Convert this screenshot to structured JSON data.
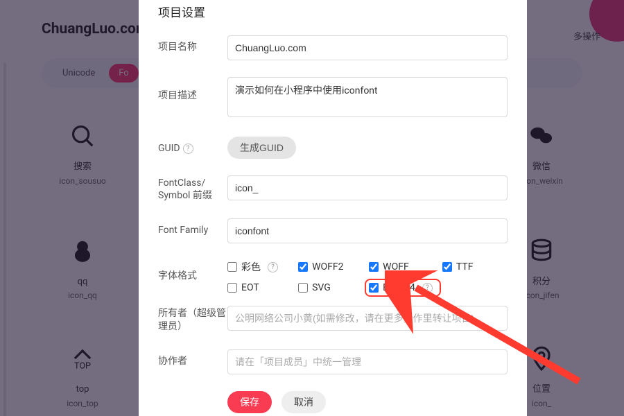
{
  "background": {
    "brand": "ChuangLuo.com",
    "more_ops": "多操作",
    "tabs": {
      "unicode": "Unicode",
      "fontclass": "Fo"
    },
    "icons": {
      "search": {
        "label": "搜索",
        "code": "icon_sousuo"
      },
      "wechat": {
        "label": "微信",
        "code": "icon_weixin"
      },
      "qq": {
        "label": "qq",
        "code": "icon_qq"
      },
      "jifen": {
        "label": "积分",
        "code": "icon_jifen"
      },
      "top": {
        "label": "top",
        "code": "icon_top"
      },
      "location": {
        "label": "位置",
        "code": "icon_"
      }
    }
  },
  "modal": {
    "title": "项目设置",
    "project_name_label": "项目名称",
    "project_name_value": "ChuangLuo.com",
    "project_desc_label": "项目描述",
    "project_desc_value": "演示如何在小程序中使用iconfont",
    "guid_label": "GUID",
    "guid_button": "生成GUID",
    "prefix_label": "FontClass/\nSymbol 前缀",
    "prefix_value": "icon_",
    "font_family_label": "Font Family",
    "font_family_value": "iconfont",
    "font_format_label": "字体格式",
    "format_options": {
      "color": "彩色",
      "woff2": "WOFF2",
      "woff": "WOFF",
      "ttf": "TTF",
      "eot": "EOT",
      "svg": "SVG",
      "base64": "Base64"
    },
    "owner_label": "所有者（超级管理员）",
    "owner_placeholder": "公明网络公司小黄(如需修改，请在更多操作里转让项目)",
    "collab_label": "协作者",
    "collab_placeholder": "请在「项目成员」中统一管理",
    "save_label": "保存",
    "cancel_label": "取消"
  },
  "checked": {
    "color": false,
    "woff2": true,
    "woff": true,
    "ttf": true,
    "eot": false,
    "svg": false,
    "base64": true
  }
}
